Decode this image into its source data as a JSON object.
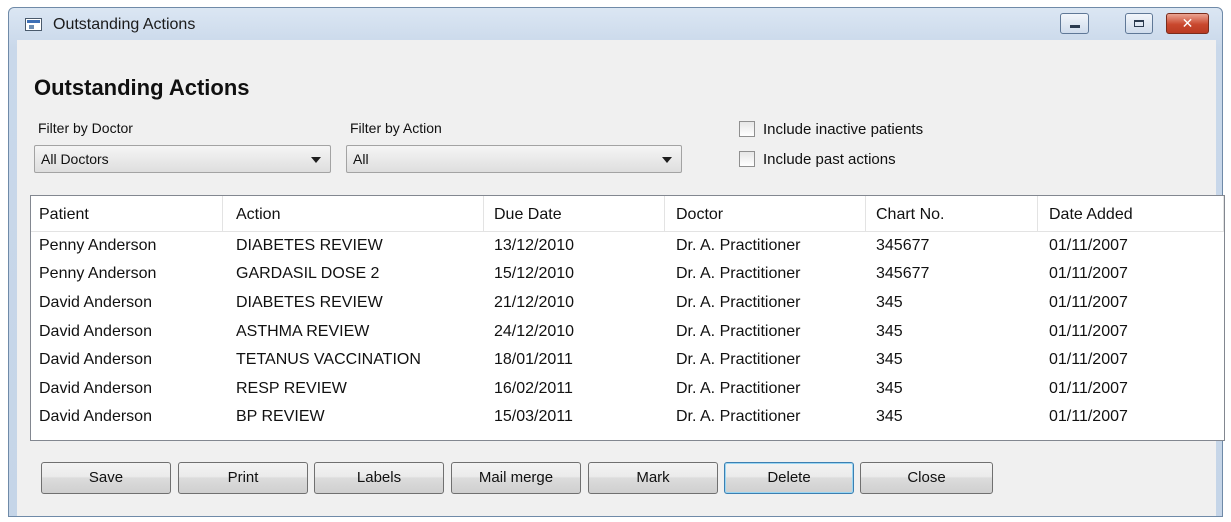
{
  "window": {
    "title": "Outstanding Actions"
  },
  "heading": "Outstanding Actions",
  "filters": {
    "doctor": {
      "label": "Filter by Doctor",
      "value": "All Doctors"
    },
    "action": {
      "label": "Filter by Action",
      "value": "All"
    }
  },
  "checkboxes": {
    "inactive": {
      "label": "Include inactive patients",
      "checked": false
    },
    "past": {
      "label": "Include past actions",
      "checked": false
    }
  },
  "table": {
    "columns": [
      "Patient",
      "Action",
      "Due Date",
      "Doctor",
      "Chart No.",
      "Date Added"
    ],
    "rows": [
      [
        "Penny Anderson",
        "DIABETES REVIEW",
        "13/12/2010",
        "Dr. A. Practitioner",
        "345677",
        "01/11/2007"
      ],
      [
        "Penny Anderson",
        "GARDASIL DOSE 2",
        "15/12/2010",
        "Dr. A. Practitioner",
        "345677",
        "01/11/2007"
      ],
      [
        "David Anderson",
        "DIABETES REVIEW",
        "21/12/2010",
        "Dr. A. Practitioner",
        "345",
        "01/11/2007"
      ],
      [
        "David Anderson",
        "ASTHMA REVIEW",
        "24/12/2010",
        "Dr. A. Practitioner",
        "345",
        "01/11/2007"
      ],
      [
        "David Anderson",
        "TETANUS VACCINATION",
        "18/01/2011",
        "Dr. A. Practitioner",
        "345",
        "01/11/2007"
      ],
      [
        "David Anderson",
        "RESP REVIEW",
        "16/02/2011",
        "Dr. A. Practitioner",
        "345",
        "01/11/2007"
      ],
      [
        "David Anderson",
        "BP REVIEW",
        "15/03/2011",
        "Dr. A. Practitioner",
        "345",
        "01/11/2007"
      ]
    ]
  },
  "buttons": {
    "save": "Save",
    "print": "Print",
    "labels": "Labels",
    "mail_merge": "Mail merge",
    "mark": "Mark",
    "delete": "Delete",
    "close": "Close"
  }
}
